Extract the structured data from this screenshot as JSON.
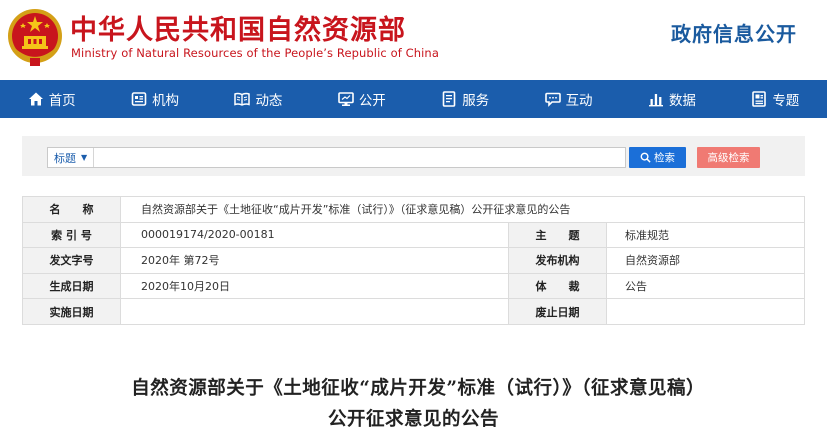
{
  "header": {
    "title": "中华人民共和国自然资源部",
    "subtitle": "Ministry of Natural Resources of the People’s Republic of China",
    "gov_info": "政府信息公开"
  },
  "nav": {
    "items": [
      {
        "label": "首页",
        "icon": "home-icon"
      },
      {
        "label": "机构",
        "icon": "org-icon"
      },
      {
        "label": "动态",
        "icon": "book-icon"
      },
      {
        "label": "公开",
        "icon": "monitor-icon"
      },
      {
        "label": "服务",
        "icon": "document-icon"
      },
      {
        "label": "互动",
        "icon": "chat-icon"
      },
      {
        "label": "数据",
        "icon": "bar-chart-icon"
      },
      {
        "label": "专题",
        "icon": "topic-icon"
      }
    ]
  },
  "search": {
    "type_label": "标题",
    "input_value": "",
    "placeholder": "",
    "search_label": "检索",
    "advanced_label": "高级检索"
  },
  "info": {
    "name_label": "名　　称",
    "name_value": "自然资源部关于《土地征收“成片开发”标准（试行）》（征求意见稿）公开征求意见的公告",
    "index_label": "索 引 号",
    "index_value": "000019174/2020-00181",
    "topic_label": "主　　题",
    "topic_value": "标准规范",
    "docno_label": "发文字号",
    "docno_value": "2020年 第72号",
    "issuer_label": "发布机构",
    "issuer_value": "自然资源部",
    "date_label": "生成日期",
    "date_value": "2020年10月20日",
    "genre_label": "体　　裁",
    "genre_value": "公告",
    "effective_label": "实施日期",
    "effective_value": "",
    "expire_label": "废止日期",
    "expire_value": ""
  },
  "article": {
    "title": "自然资源部关于《土地征收“成片开发”标准（试行）》（征求意见稿）公开征求意见的公告"
  },
  "colors": {
    "brand_red": "#c8151d",
    "nav_blue": "#1b5dac",
    "search_blue": "#1b6fd8",
    "advanced_red": "#f07a73"
  }
}
